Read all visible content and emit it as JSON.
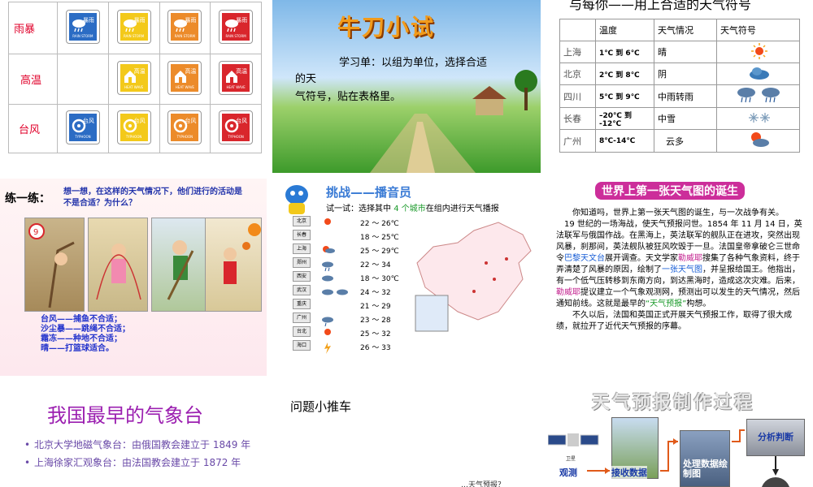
{
  "slide1": {
    "rows": [
      {
        "label": "雨暴",
        "cards": [
          {
            "color": "#2b6cc4",
            "cn": "暴雨",
            "en": "RAIN STORM"
          },
          {
            "color": "#f3c91a",
            "cn": "暴雨",
            "en": "RAIN STORM"
          },
          {
            "color": "#ec8b2a",
            "cn": "暴雨",
            "en": "RAIN STORM"
          },
          {
            "color": "#d9262c",
            "cn": "暴雨",
            "en": "RAIN STORM"
          }
        ]
      },
      {
        "label": "高温",
        "cards": [
          {
            "color": "#f3c91a",
            "cn": "高温",
            "en": "HEAT WAVE"
          },
          {
            "color": "#ec8b2a",
            "cn": "高温",
            "en": "HEAT WAVE"
          },
          {
            "color": "#d9262c",
            "cn": "高温",
            "en": "HEAT WAVE"
          }
        ]
      },
      {
        "label": "台风",
        "cards": [
          {
            "color": "#2b6cc4",
            "cn": "台风",
            "en": "TYPHOON"
          },
          {
            "color": "#f3c91a",
            "cn": "台风",
            "en": "TYPHOON"
          },
          {
            "color": "#ec8b2a",
            "cn": "台风",
            "en": "TYPHOON"
          },
          {
            "color": "#d9262c",
            "cn": "台风",
            "en": "TYPHOON"
          }
        ]
      }
    ]
  },
  "slide2": {
    "title": "牛刀小试",
    "line1": "学习单：以组为单位，选择合适",
    "line2": "的天",
    "line3": "气符号，贴在表格里。"
  },
  "slide3": {
    "title": "与每你——用上合适的天气符号",
    "headers": [
      "",
      "温度",
      "天气情况",
      "天气符号"
    ],
    "rows": [
      {
        "city": "上海",
        "temp": "1℃ 到 6℃",
        "cond": "晴"
      },
      {
        "city": "北京",
        "temp": "2℃ 到 8℃",
        "cond": "阴"
      },
      {
        "city": "四川",
        "temp": "5℃ 到 9℃",
        "cond": "中雨转雨"
      },
      {
        "city": "长春",
        "temp": "–20℃ 到 -12℃",
        "cond": "中雪"
      },
      {
        "city": "广州",
        "temp": "8℃-14℃",
        "cond": "云多"
      }
    ]
  },
  "slide4": {
    "heading": "练一练：",
    "question": "想一想，在这样的天气情况下，他们进行的活动是不是合适？为什么？",
    "answers": [
      "台风——捕鱼不合适；",
      "沙尘暴——跳绳不合适；",
      "霜冻——种地不合适；",
      "晴——打篮球适合。"
    ]
  },
  "slide5": {
    "title": "挑战——播音员",
    "subtitle_pre": "试一试：选择其中 ",
    "subtitle_hl": "4 个城市",
    "subtitle_post": "在组内进行天气播报",
    "cities": [
      {
        "name": "北京",
        "range": "22 ～ 26℃"
      },
      {
        "name": "长春",
        "range": "18 ～ 25℃"
      },
      {
        "name": "上海",
        "range": "25 ～ 29℃"
      },
      {
        "name": "郑州",
        "range": "22 ～ 34"
      },
      {
        "name": "西安",
        "range": "18 ～ 30℃"
      },
      {
        "name": "武汉",
        "range": "24 ～ 32"
      },
      {
        "name": "重庆",
        "range": "21 ～ 29"
      },
      {
        "name": "广州",
        "range": "23 ～ 28"
      },
      {
        "name": "台北",
        "range": "25 ～ 32"
      },
      {
        "name": "海口",
        "range": "26 ～ 33"
      }
    ]
  },
  "slide6": {
    "title": "世界上第一张天气图的诞生",
    "p1": "你知道吗，世界上第一张天气图的诞生，与一次战争有关。",
    "p2a": "19 世纪的一场海战，使天气预报问世。1854 年 11 月 14 日，英法联军与俄国作战。在黑海上，英法联军的舰队正在进攻，突然出现风暴，刹那间，英法舰队被狂风吹毁于一旦。法国皇帝拿破仑三世命令",
    "p2b": "巴黎天文台",
    "p2c": "展开调查。天文学家",
    "p2d": "勒威耶",
    "p2e": "搜集了各种气象资料，终于弄清楚了风暴的原因，绘制了",
    "p2f": "一张天气图",
    "p2g": "，并呈报给国王。他指出，有一个低气压转移到东南方向，到达黑海时，造成这次灾难。后来，",
    "p2h": "勒威耶",
    "p2i": "提议建立一个气象观测网，预测出可以发生的天气情况，然后通知前线。这就是最早的",
    "p2j": "“天气预报”",
    "p2k": "构想。",
    "p3": "不久以后，法国和英国正式开展天气预报工作，取得了很大成绩，就拉开了近代天气预报的序幕。"
  },
  "slide7": {
    "title": "我国最早的气象台",
    "items": [
      "北京大学地磁气象台：由俄国教会建立于 1849 年",
      "上海徐家汇观象台：由法国教会建立于 1872 年"
    ]
  },
  "slide8": {
    "title": "问题小推车",
    "fragment": "…天气预报？"
  },
  "slide9": {
    "title": "天气预报制作过程",
    "satellite": "卫星",
    "observe": "观测",
    "receive": "接收数据",
    "process": "处理数据绘制图",
    "analyze": "分析判断"
  }
}
